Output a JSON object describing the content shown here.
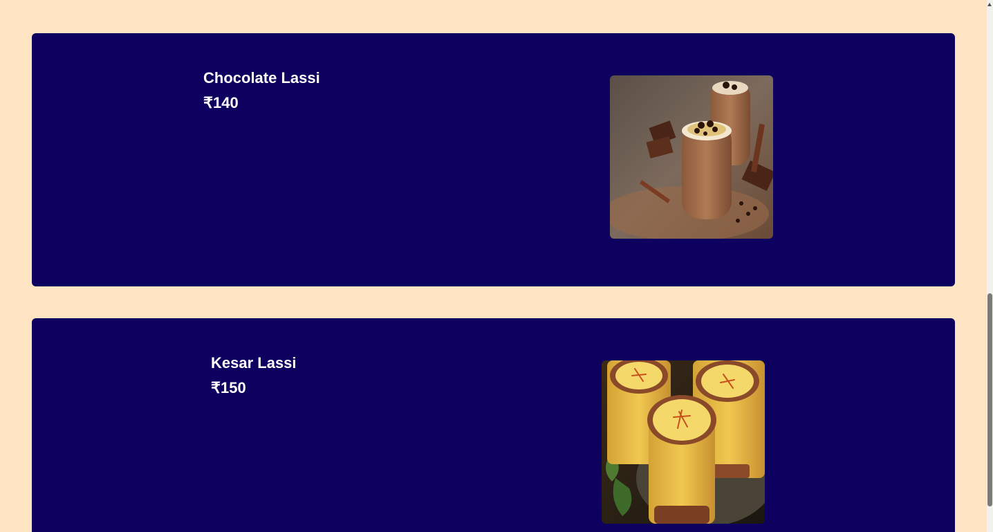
{
  "menu": {
    "items": [
      {
        "name": "Chocolate Lassi",
        "price": "₹140",
        "image_icon": "chocolate-lassi-photo"
      },
      {
        "name": "Kesar Lassi",
        "price": "₹150",
        "image_icon": "kesar-lassi-photo"
      }
    ]
  },
  "colors": {
    "page_background": "#ffe4c4",
    "card_background": "#0e005e",
    "text": "#ffffff"
  }
}
